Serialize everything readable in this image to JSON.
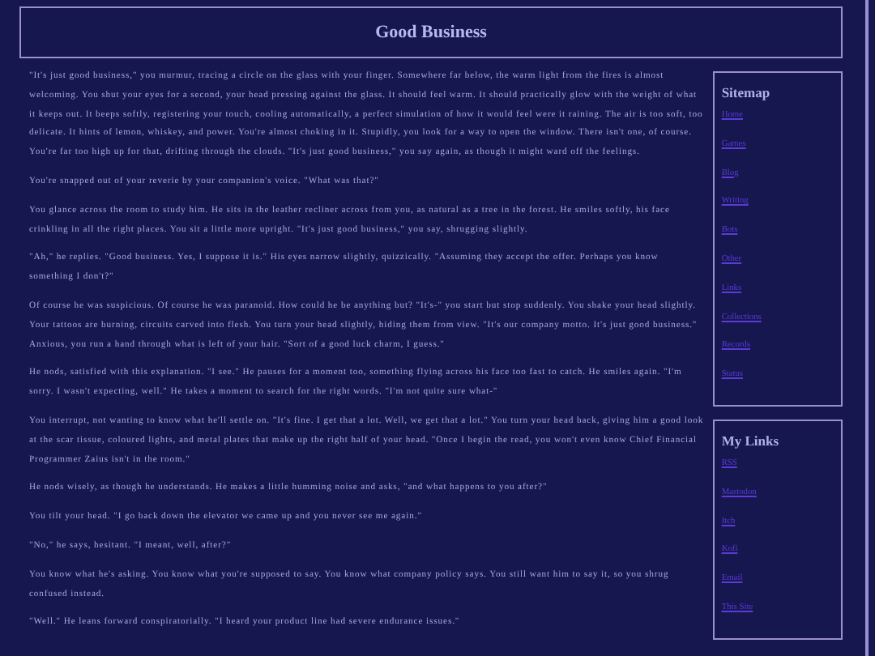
{
  "header": {
    "title": "Good Business"
  },
  "paragraphs": [
    "\"It's just good business,\" you murmur, tracing a circle on the glass with your finger. Somewhere far below, the warm light from the fires is almost welcoming. You shut your eyes for a second, your head pressing against the glass. It should feel warm. It should practically glow with the weight of what it keeps out. It beeps softly, registering your touch, cooling automatically, a perfect simulation of how it would feel were it raining. The air is too soft, too delicate. It hints of lemon, whiskey, and power. You're almost choking in it. Stupidly, you look for a way to open the window. There isn't one, of course. You're far too high up for that, drifting through the clouds. \"It's just good business,\" you say again, as though it might ward off the feelings.",
    "You're snapped out of your reverie by your companion's voice. \"What was that?\"",
    "You glance across the room to study him. He sits in the leather recliner across from you, as natural as a tree in the forest. He smiles softly, his face crinkling in all the right places. You sit a little more upright. \"It's just good business,\" you say, shrugging slightly.",
    "\"Ah,\" he replies. \"Good business. Yes, I suppose it is.\" His eyes narrow slightly, quizzically. \"Assuming they accept the offer. Perhaps you know something I don't?\"",
    "Of course he was suspicious. Of course he was paranoid. How could he be anything but? \"It's-\" you start but stop suddenly. You shake your head slightly. Your tattoos are burning, circuits carved into flesh. You turn your head slightly, hiding them from view. \"It's our company motto. It's just good business.\" Anxious, you run a hand through what is left of your hair. \"Sort of a good luck charm, I guess.\"",
    "He nods, satisfied with this explanation. \"I see.\" He pauses for a moment too, something flying across his face too fast to catch. He smiles again. \"I'm sorry. I wasn't expecting, well.\" He takes a moment to search for the right words. \"I'm not quite sure what-\"",
    "You interrupt, not wanting to know what he'll settle on. \"It's fine. I get that a lot. Well, we get that a lot.\" You turn your head back, giving him a good look at the scar tissue, coloured lights, and metal plates that make up the right half of your head. \"Once I begin the read, you won't even know Chief Financial Programmer Zaius isn't in the room.\"",
    "He nods wisely, as though he understands. He makes a little humming noise and asks, \"and what happens to you after?\"",
    "You tilt your head. \"I go back down the elevator we came up and you never see me again.\"",
    "\"No,\" he says, hesitant. \"I meant, well, after?\"",
    "You know what he's asking. You know what you're supposed to say. You know what company policy says. You still want him to say it, so you shrug confused instead.",
    "\"Well.\" He leans forward conspiratorially. \"I heard your product line had severe endurance issues.\""
  ],
  "sidebar": [
    {
      "title": "Sitemap",
      "links": [
        "Home",
        "Games",
        "Blog",
        "Writing",
        "Bots",
        "Other",
        "Links",
        "Collections",
        "Records",
        "Status"
      ]
    },
    {
      "title": "My Links",
      "links": [
        "RSS",
        "Mastodon",
        "Itch",
        "Kofi",
        "Email",
        "This Site"
      ]
    }
  ]
}
